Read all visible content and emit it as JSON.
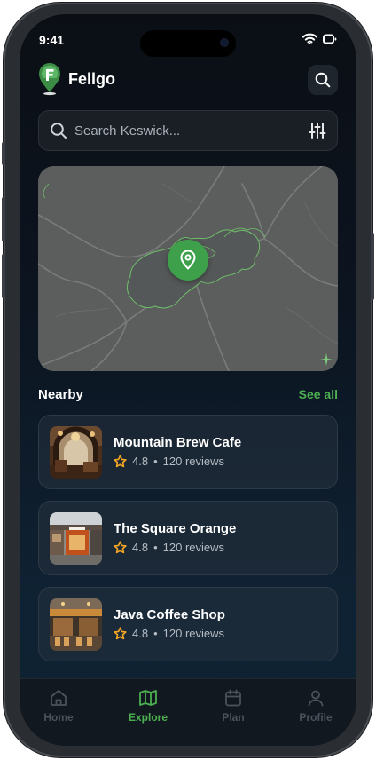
{
  "status_bar": {
    "time": "9:41"
  },
  "app": {
    "title": "Fellgo"
  },
  "search": {
    "placeholder": "Search Keswick..."
  },
  "nearby": {
    "title": "Nearby",
    "see_all": "See all",
    "items": [
      {
        "name": "Mountain Brew Cafe",
        "rating": "4.8",
        "separator": "•",
        "reviews": "120 reviews"
      },
      {
        "name": "The Square Orange",
        "rating": "4.8",
        "separator": "•",
        "reviews": "120 reviews"
      },
      {
        "name": "Java Coffee Shop",
        "rating": "4.8",
        "separator": "•",
        "reviews": "120 reviews"
      }
    ]
  },
  "tabs": [
    {
      "label": "Home",
      "icon": "home-icon",
      "active": false
    },
    {
      "label": "Explore",
      "icon": "map-icon",
      "active": true
    },
    {
      "label": "Plan",
      "icon": "calendar-icon",
      "active": false
    },
    {
      "label": "Profile",
      "icon": "user-icon",
      "active": false
    }
  ],
  "colors": {
    "accent": "#4caf50",
    "pin": "#3fa04c",
    "star": "#f5a623",
    "background_top": "#0b0f15",
    "background_bottom": "#0f2233"
  }
}
